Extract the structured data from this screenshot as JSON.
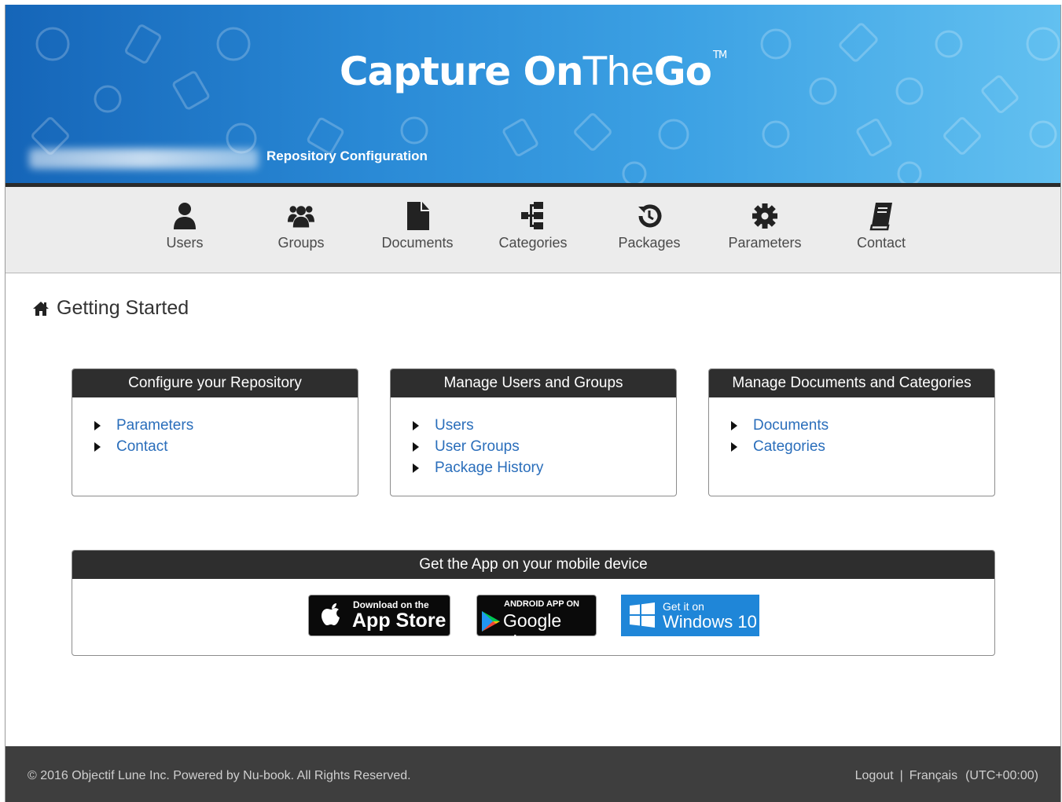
{
  "header": {
    "logo_bold": "Capture On",
    "logo_thin": "The",
    "logo_end": "Go",
    "logo_tm": "TM",
    "subtitle": "Repository Configuration"
  },
  "nav": {
    "items": [
      {
        "label": "Users",
        "icon": "user-icon"
      },
      {
        "label": "Groups",
        "icon": "users-icon"
      },
      {
        "label": "Documents",
        "icon": "file-icon"
      },
      {
        "label": "Categories",
        "icon": "sitemap-icon"
      },
      {
        "label": "Packages",
        "icon": "history-icon"
      },
      {
        "label": "Parameters",
        "icon": "gear-icon"
      },
      {
        "label": "Contact",
        "icon": "book-icon"
      }
    ]
  },
  "breadcrumb": {
    "icon": "home-icon",
    "title": "Getting Started"
  },
  "panels": [
    {
      "title": "Configure your Repository",
      "links": [
        "Parameters",
        "Contact"
      ]
    },
    {
      "title": "Manage Users and Groups",
      "links": [
        "Users",
        "User Groups",
        "Package History"
      ]
    },
    {
      "title": "Manage Documents and Categories",
      "links": [
        "Documents",
        "Categories"
      ]
    }
  ],
  "app_panel": {
    "title": "Get the App on your mobile device",
    "appstore": {
      "small": "Download on the",
      "big": "App Store"
    },
    "googleplay": {
      "small": "ANDROID APP ON",
      "big": "Google play"
    },
    "windows": {
      "small": "Get it on",
      "big": "Windows 10"
    }
  },
  "footer": {
    "copyright": "© 2016 Objectif Lune Inc. Powered by Nu-book. All Rights Reserved.",
    "logout": "Logout",
    "separator": "|",
    "language": "Français",
    "timezone": "(UTC+00:00)"
  },
  "colors": {
    "banner_start": "#1565b8",
    "banner_end": "#62c0f0",
    "link": "#2a6ebb",
    "panel_header": "#2e2e2e",
    "footer": "#3e3e3e"
  }
}
